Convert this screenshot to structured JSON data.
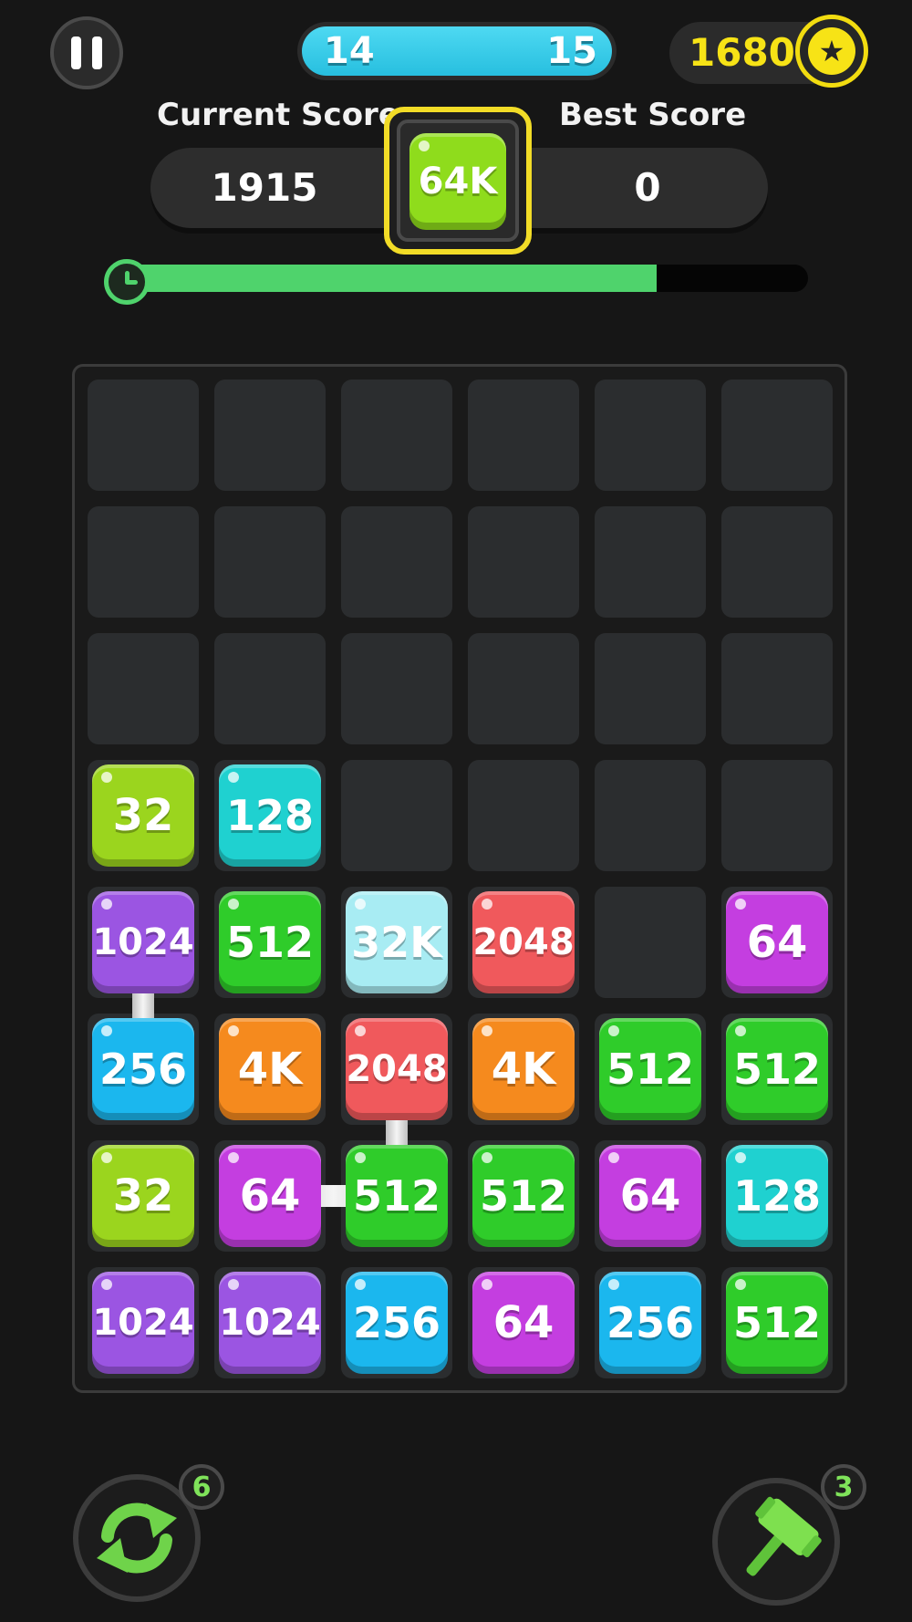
{
  "header": {
    "level_current": "14",
    "level_next": "15",
    "coins": "1680",
    "coin_icon": "star-icon"
  },
  "score": {
    "current_label": "Current Score",
    "current_value": "1915",
    "best_label": "Best Score",
    "best_value": "0",
    "target_tile": "64K"
  },
  "timer": {
    "remaining_fraction": 0.78,
    "icon": "clock-icon"
  },
  "board": {
    "columns": 6,
    "rows": 8,
    "tiles": [
      [
        "",
        "",
        "",
        "",
        "",
        ""
      ],
      [
        "",
        "",
        "",
        "",
        "",
        ""
      ],
      [
        "",
        "",
        "",
        "",
        "",
        ""
      ],
      [
        "32",
        "128",
        "",
        "",
        "",
        ""
      ],
      [
        "1024",
        "512",
        "32K",
        "2048",
        "",
        "64"
      ],
      [
        "256",
        "4K",
        "2048",
        "4K",
        "512",
        "512"
      ],
      [
        "32",
        "64",
        "512",
        "512",
        "64",
        "128"
      ],
      [
        "1024",
        "1024",
        "256",
        "64",
        "256",
        "512"
      ]
    ],
    "merge_chain": [
      [
        4,
        0
      ],
      [
        5,
        0
      ]
    ],
    "merge_chain_2": [
      [
        5,
        2
      ],
      [
        6,
        2
      ],
      [
        6,
        1
      ]
    ]
  },
  "tile_colors": {
    "32": "#9bd51e",
    "64": "#c43ee0",
    "128": "#1fd1d0",
    "256": "#1bb7ee",
    "512": "#2fcc2a",
    "1024": "#9b55e2",
    "2048": "#f0595c",
    "4K": "#f58a1e",
    "32K": "#a8ecf3",
    "64K": "#8fdc1c"
  },
  "tools": {
    "swap_count": "6",
    "swap_icon": "swap-arrows-icon",
    "hammer_count": "3",
    "hammer_icon": "hammer-icon"
  }
}
